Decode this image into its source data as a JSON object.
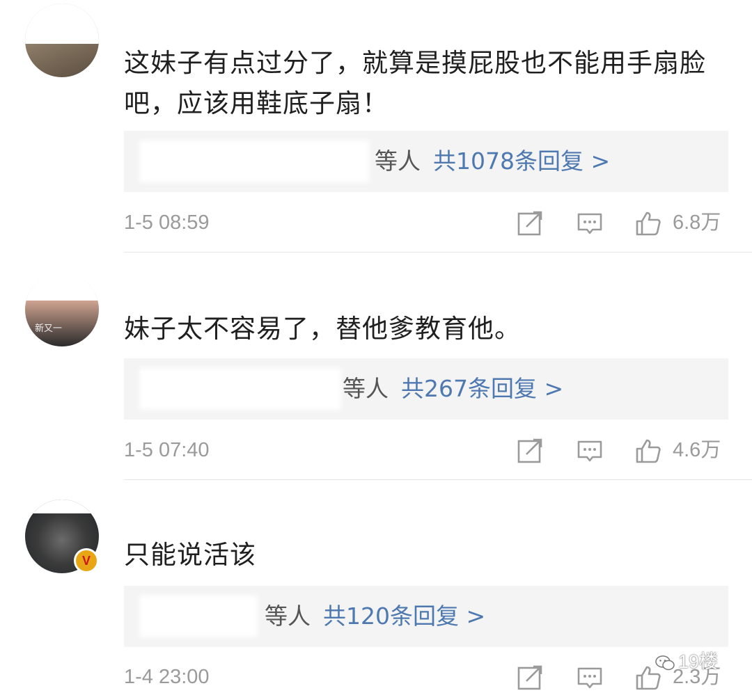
{
  "comments": [
    {
      "text": "这妹子有点过分了，就算是摸屁股也不能用手扇脸吧，应该用鞋底子扇！",
      "reply_others": "等人",
      "reply_count": "共1078条回复 >",
      "time": "1-5 08:59",
      "likes": "6.8万"
    },
    {
      "text": "妹子太不容易了，替他爹教育他。",
      "reply_others": "等人",
      "reply_count": "共267条回复 >",
      "time": "1-5 07:40",
      "likes": "4.6万",
      "avatar_caption": "新又一"
    },
    {
      "text": "只能说活该",
      "reply_others": "等人",
      "reply_count": "共120条回复 >",
      "time": "1-4 23:00",
      "likes": "2.3万",
      "verified_badge": "V"
    }
  ],
  "icons": {
    "share": "share-icon",
    "comment": "comment-icon",
    "like": "thumbs-up-icon"
  },
  "watermark": "19楼",
  "colors": {
    "link": "#4d79b0",
    "meta": "#9a9a9a",
    "reply_bg": "#f4f4f4",
    "badge": "#e8a614"
  }
}
